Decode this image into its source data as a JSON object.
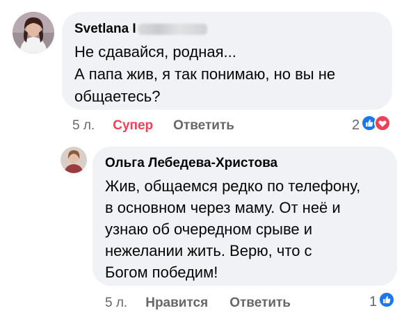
{
  "comment": {
    "author_visible": "Svetlana I",
    "text": "Не сдавайся, родная...\nА папа жив, я так понимаю, но вы не\nобщаетесь?",
    "age": "5 л.",
    "reaction_label": "Супер",
    "reply_label": "Ответить",
    "reaction_count": "2",
    "reaction_color": "#f33e58"
  },
  "reply": {
    "author": "Ольга Лебедева-Христова",
    "text": "Жив, общаемся редко по телефону,\nв основном через маму. От неё и\nузнаю об очередном срыве и\nнежелании жить. Верю, что с\nБогом победим!",
    "age": "5 л.",
    "like_label": "Нравится",
    "reply_label": "Ответить",
    "reaction_count": "1"
  },
  "colors": {
    "like_blue": "#1877f2",
    "love_red": "#f33e58",
    "bubble_bg": "#f0f2f5",
    "meta_gray": "#65676b"
  }
}
